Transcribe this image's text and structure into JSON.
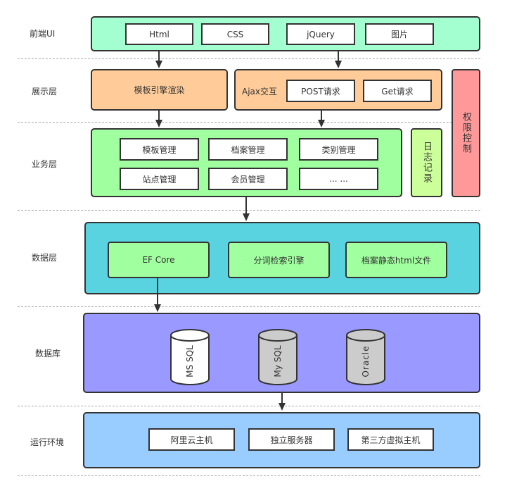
{
  "colors": {
    "frontend": "#a3ffd0",
    "presentation": "#ffcc99",
    "business": "#a0ff9e",
    "log": "#ccff99",
    "auth": "#ff9999",
    "data_layer": "#59d3e0",
    "data_inner": "#a0ff9e",
    "database": "#9999ff",
    "runtime": "#99ccff",
    "cyl_white": "#ffffff",
    "cyl_gray": "#cccccc"
  },
  "layers": {
    "frontend": {
      "label": "前端UI",
      "items": [
        "Html",
        "CSS",
        "jQuery",
        "图片"
      ]
    },
    "presentation": {
      "label": "展示层",
      "template_engine": "模板引擎渲染",
      "ajax_label": "Ajax交互",
      "ajax_items": [
        "POST请求",
        "Get请求"
      ]
    },
    "business": {
      "label": "业务层",
      "items": [
        "模板管理",
        "档案管理",
        "类别管理",
        "站点管理",
        "会员管理",
        "... ..."
      ]
    },
    "log": {
      "label": "日志记录"
    },
    "auth": {
      "label": "权限控制"
    },
    "data": {
      "label": "数据层",
      "items": [
        "EF Core",
        "分词检索引擎",
        "档案静态html文件"
      ]
    },
    "database": {
      "label": "数据库",
      "items": [
        "MS SQL",
        "My SQL",
        "Oracle"
      ]
    },
    "runtime": {
      "label": "运行环境",
      "items": [
        "阿里云主机",
        "独立服务器",
        "第三方虚拟主机"
      ]
    }
  }
}
